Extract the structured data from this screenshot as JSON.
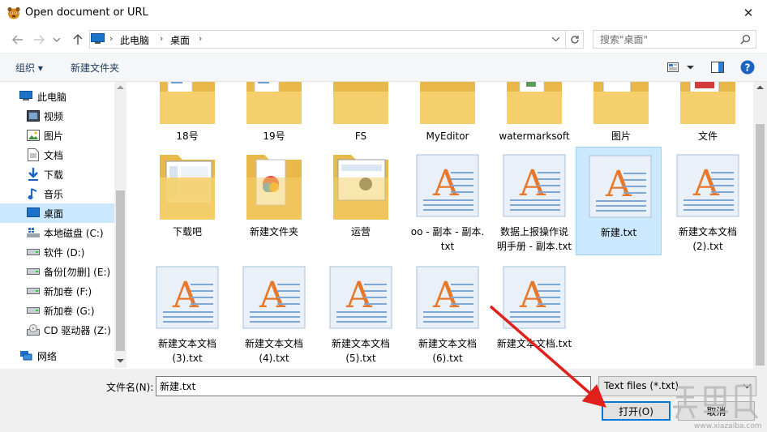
{
  "window": {
    "title": "Open document or URL",
    "close_glyph": "✕"
  },
  "address": {
    "crumbs": [
      "此电脑",
      "桌面"
    ],
    "search_placeholder": "搜索\"桌面\""
  },
  "toolbar": {
    "organize": "组织 ▾",
    "new_folder": "新建文件夹"
  },
  "nav": {
    "items": [
      {
        "label": "此电脑",
        "icon": "computer-icon"
      },
      {
        "label": "视频",
        "icon": "video-icon"
      },
      {
        "label": "图片",
        "icon": "pictures-icon"
      },
      {
        "label": "文档",
        "icon": "documents-icon"
      },
      {
        "label": "下载",
        "icon": "download-icon"
      },
      {
        "label": "音乐",
        "icon": "music-icon"
      },
      {
        "label": "桌面",
        "icon": "desktop-icon",
        "selected": true
      },
      {
        "label": "本地磁盘 (C:)",
        "icon": "windows-drive-icon"
      },
      {
        "label": "软件 (D:)",
        "icon": "drive-icon"
      },
      {
        "label": "备份[勿删] (E:)",
        "icon": "drive-icon"
      },
      {
        "label": "新加卷 (F:)",
        "icon": "drive-icon"
      },
      {
        "label": "新加卷 (G:)",
        "icon": "drive-icon"
      },
      {
        "label": "CD 驱动器 (Z:)",
        "icon": "cd-drive-icon"
      },
      {
        "label": "网络",
        "icon": "network-icon"
      }
    ]
  },
  "files": {
    "row1": [
      "18号",
      "19号",
      "FS",
      "MyEditor",
      "watermarksoft",
      "图片",
      "文件"
    ],
    "row2": [
      {
        "l1": "下载吧",
        "l2": ""
      },
      {
        "l1": "新建文件夹",
        "l2": ""
      },
      {
        "l1": "运营",
        "l2": ""
      },
      {
        "l1": "oo - 副本 - 副本.",
        "l2": "txt"
      },
      {
        "l1": "数据上报操作说",
        "l2": "明手册 - 副本.txt"
      },
      {
        "l1": "新建.txt",
        "l2": ""
      },
      {
        "l1": "新建文本文档",
        "l2": "(2).txt"
      }
    ],
    "row3": [
      {
        "l1": "新建文本文档",
        "l2": "(3).txt"
      },
      {
        "l1": "新建文本文档",
        "l2": "(4).txt"
      },
      {
        "l1": "新建文本文档",
        "l2": "(5).txt"
      },
      {
        "l1": "新建文本文档",
        "l2": "(6).txt"
      },
      {
        "l1": "新建文本文档.txt",
        "l2": ""
      }
    ]
  },
  "bottom": {
    "filename_label": "文件名(N):",
    "filename_value": "新建.txt",
    "filetype": "Text files (*.txt)",
    "open_button": "打开(O)",
    "cancel_button": "取消"
  },
  "colors": {
    "accent": "#0078d7",
    "selection": "#cce8ff",
    "annotation_arrow": "#e0201b"
  }
}
